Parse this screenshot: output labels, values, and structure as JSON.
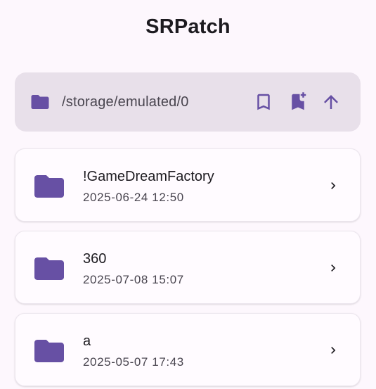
{
  "app": {
    "title": "SRPatch"
  },
  "path_bar": {
    "path": "/storage/emulated/0",
    "actions": [
      {
        "icon": "bookmark-icon"
      },
      {
        "icon": "bookmark-add-icon"
      },
      {
        "icon": "arrow-up-icon"
      }
    ]
  },
  "files": [
    {
      "name": "!GameDreamFactory",
      "modified": "2025-06-24 12:50",
      "icon": "folder-icon"
    },
    {
      "name": "360",
      "modified": "2025-07-08 15:07",
      "icon": "folder-icon"
    },
    {
      "name": "a",
      "modified": "2025-05-07 17:43",
      "icon": "folder-icon"
    }
  ],
  "colors": {
    "background": "#fdf7fd",
    "path_bar_bg": "#e8e0ea",
    "accent": "#6750a4",
    "text_primary": "#1d1b20",
    "text_secondary": "#49454f"
  }
}
